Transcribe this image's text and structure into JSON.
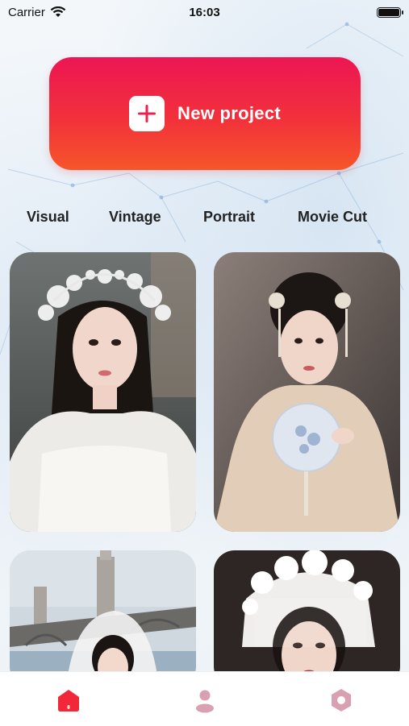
{
  "status_bar": {
    "carrier": "Carrier",
    "time": "16:03"
  },
  "new_project": {
    "label": "New project"
  },
  "tabs": [
    {
      "label": "Visual"
    },
    {
      "label": "Vintage"
    },
    {
      "label": "Portrait"
    },
    {
      "label": "Movie Cut"
    }
  ],
  "gallery": {
    "items": [
      {
        "subject": "bride-with-pearl-crown"
      },
      {
        "subject": "bride-with-gold-hairpins-and-fan"
      },
      {
        "subject": "bride-with-veil-by-bridge"
      },
      {
        "subject": "bride-with-flower-headpiece"
      }
    ]
  },
  "bottom_nav": [
    {
      "icon": "home-icon",
      "active": true,
      "color": "#f0283a"
    },
    {
      "icon": "profile-icon",
      "active": false,
      "color": "#d9a0b2"
    },
    {
      "icon": "settings-icon",
      "active": false,
      "color": "#d9a0b2"
    }
  ],
  "colors": {
    "accent_top": "#ec1654",
    "accent_bottom": "#f6562a"
  }
}
